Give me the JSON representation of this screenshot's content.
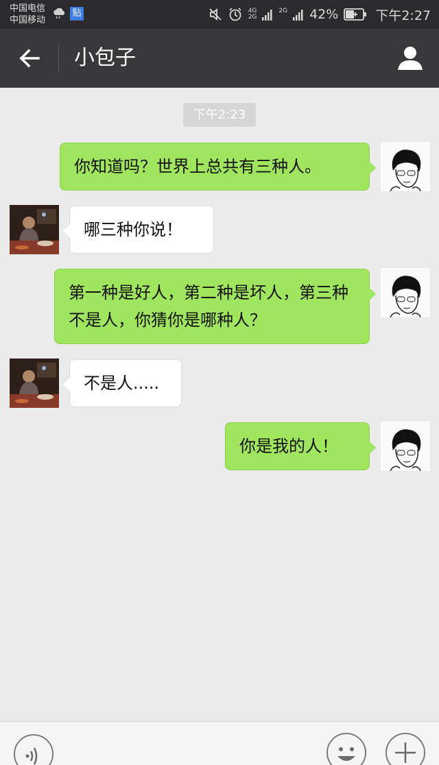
{
  "status_bar": {
    "carrier_1": "中国电信",
    "carrier_2": "中国移动",
    "tieba_badge": "贴",
    "net_type_top": "4G",
    "net_type_bottom": "2G",
    "net_type_2": "2G",
    "battery_percent": "42%",
    "time": "下午2:27"
  },
  "title_bar": {
    "title": "小包子",
    "back_icon": "arrow-left-icon",
    "profile_icon": "person-icon"
  },
  "chat": {
    "timestamp": "下午2:23",
    "messages": [
      {
        "sender": "self",
        "text": "你知道吗？世界上总共有三种人。"
      },
      {
        "sender": "friend",
        "text": "哪三种你说！"
      },
      {
        "sender": "self",
        "text": "第一种是好人，第二种是坏人，第三种不是人，你猜你是哪种人？"
      },
      {
        "sender": "friend",
        "text": "不是人....."
      },
      {
        "sender": "self",
        "text": "你是我的人！"
      }
    ]
  },
  "colors": {
    "self_bubble": "#9fe55d",
    "friend_bubble": "#ffffff",
    "title_bar": "#38383b",
    "chat_background": "#ebebeb"
  },
  "input_bar": {
    "voice_icon": "voice-icon",
    "emoji_icon": "smiley-icon",
    "plus_icon": "plus-icon"
  }
}
